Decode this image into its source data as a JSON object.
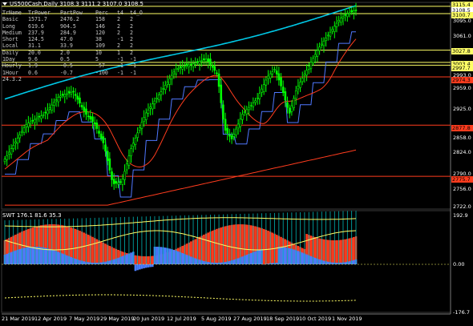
{
  "chart": {
    "symbol_title": "US500Cash,Daily  3108.3 3111.2 3107.0 3108.5",
    "indicator_title": "SWT 176.1 81.6 35.3"
  },
  "info_table": {
    "headers": [
      "TrName",
      "TrPower",
      "PartPow",
      "Perc",
      "t4",
      "t4_O"
    ],
    "rows": [
      [
        "Basic",
        "1571.7",
        "2476.2",
        "158",
        "2",
        "2"
      ],
      [
        "Long",
        "619.6",
        "904.5",
        "146",
        "2",
        "2"
      ],
      [
        "Medium",
        "237.9",
        "284.9",
        "120",
        "2",
        "2"
      ],
      [
        "Short",
        "124.5",
        "47.0",
        "38",
        "-1",
        "2"
      ],
      [
        "Local",
        "31.1",
        "33.9",
        "109",
        "2",
        "2"
      ],
      [
        "Daily",
        "20.0",
        "2.0",
        "10",
        "1",
        "2"
      ],
      [
        "1Day",
        "9.6",
        "0.5",
        "5",
        "-1",
        "-1"
      ],
      [
        "Hourly",
        "1.9",
        "-0.5",
        "-57",
        "-1",
        "-1"
      ],
      [
        "1Hour",
        "0.6",
        "-0.7",
        "-100",
        "-1",
        "-1"
      ],
      [
        "24.3.2",
        "",
        "",
        "",
        "",
        ""
      ]
    ]
  },
  "price_axis": {
    "labels": [
      "3095.0",
      "3061.0",
      "2993.0",
      "2959.0",
      "2925.0",
      "2858.0",
      "2824.0",
      "2790.0",
      "2756.0",
      "2722.0"
    ],
    "badges": [
      {
        "text": "3115.4",
        "color": "#ffff66"
      },
      {
        "text": "3108.5",
        "color": "#ffffff"
      },
      {
        "text": "3100.7",
        "color": "#ffff66"
      },
      {
        "text": "3027.8",
        "color": "#ffff66"
      },
      {
        "text": "3003.4",
        "color": "#ffff66"
      },
      {
        "text": "2997.7",
        "color": "#ffff66"
      },
      {
        "text": "2974.3",
        "color": "#ff3c1e"
      },
      {
        "text": "2877.8",
        "color": "#ff3c1e"
      },
      {
        "text": "2775.7",
        "color": "#ff3c1e"
      }
    ]
  },
  "indicator_axis": {
    "labels": [
      "192.9",
      "0.00",
      "-176.7"
    ]
  },
  "time_axis": {
    "labels": [
      "21 Mar 2019",
      "12 Apr 2019",
      "7 May 2019",
      "29 May 2019",
      "20 Jun 2019",
      "12 Jul 2019",
      "5 Aug 2019",
      "27 Aug 2019",
      "18 Sep 2019",
      "10 Oct 2019",
      "1 Nov 2019"
    ]
  },
  "colors": {
    "background": "#000000",
    "candle": "#00ff00",
    "ma_cyan": "#00c8e6",
    "ma_red": "#ff3c1e",
    "step_blue": "#5078ff",
    "level_yellow": "#ffff66",
    "level_red": "#ff3c1e",
    "hist_red": "#ff3c1e",
    "hist_blue": "#4a7dff",
    "hist_teal": "#00b4b4"
  }
}
